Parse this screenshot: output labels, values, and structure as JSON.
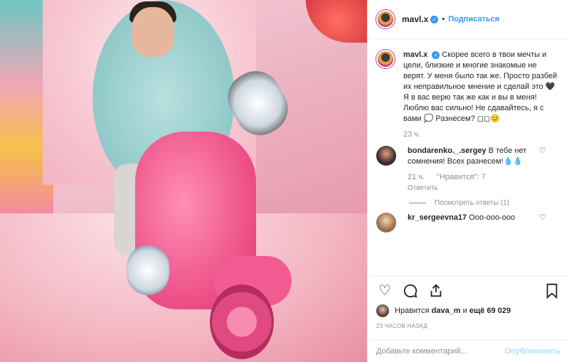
{
  "post": {
    "username": "mavl.x",
    "follow_label": "Подписаться"
  },
  "caption": {
    "username": "mavl.x",
    "text": "Скорее всего в твои мечты и цели, близкие и многие знакомые не верят. У меня было так же. Просто разбей их неправильное мнение и сделай это 🖤 Я в вас верю так же как и вы в меня! Люблю вас сильно! Не сдавайтесь, я с вами 💭 Разнесем? ◻◻😊",
    "time": "23 ч."
  },
  "comments": [
    {
      "username": "bondarenko._.sergey",
      "text": "В тебе нет сомнения! Всех разнесем!💧💧",
      "time": "21 ч.",
      "likes": "\"Нравится\": 7",
      "reply_label": "Ответить",
      "view_replies_label": "Посмотреть ответы (1)"
    },
    {
      "username": "kr_sergeevna17",
      "text": "Ооо-ооо-ооо"
    }
  ],
  "likes": {
    "prefix": "Нравится",
    "user": "dava_m",
    "suffix": "и",
    "others": "ещё 69 029"
  },
  "timestamp": "23 ЧАСОВ НАЗАД",
  "add_comment": {
    "placeholder": "Добавьте комментарий...",
    "publish_label": "Опубликовать"
  },
  "icons": [
    "heart-icon",
    "comment-icon",
    "share-icon",
    "bookmark-icon",
    "verified-icon"
  ]
}
